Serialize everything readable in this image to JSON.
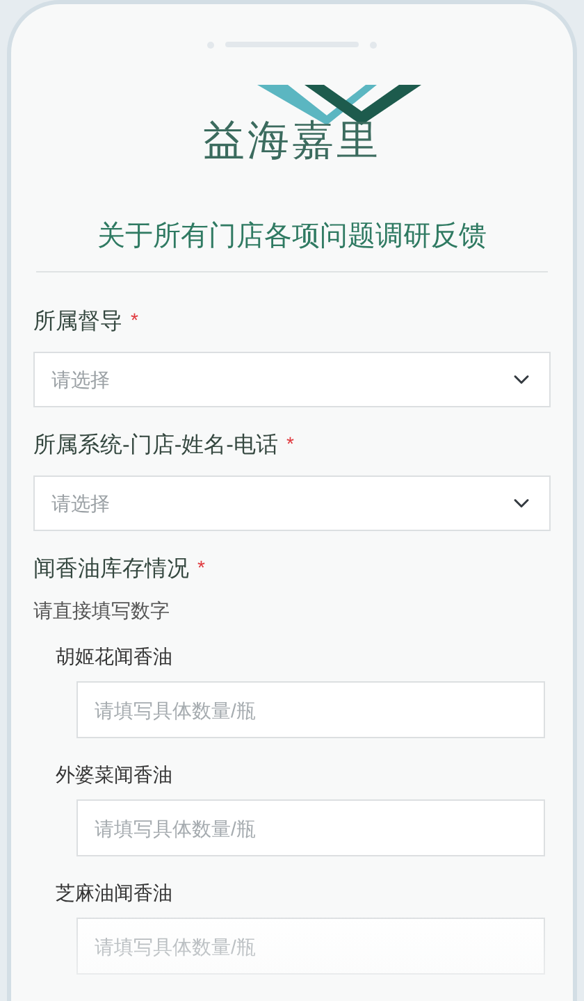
{
  "logo": {
    "text": "益海嘉里"
  },
  "title": "关于所有门店各项问题调研反馈",
  "fields": [
    {
      "kind": "select",
      "label": "所属督导",
      "required_mark": "*",
      "placeholder": "请选择"
    },
    {
      "kind": "select",
      "label": "所属系统-门店-姓名-电话",
      "required_mark": "*",
      "placeholder": "请选择"
    },
    {
      "kind": "group",
      "label": "闻香油库存情况",
      "required_mark": "*",
      "hint": "请直接填写数字",
      "items": [
        {
          "label": "胡姬花闻香油",
          "placeholder": "请填写具体数量/瓶"
        },
        {
          "label": "外婆菜闻香油",
          "placeholder": "请填写具体数量/瓶"
        },
        {
          "label": "芝麻油闻香油",
          "placeholder": "请填写具体数量/瓶"
        }
      ]
    }
  ]
}
